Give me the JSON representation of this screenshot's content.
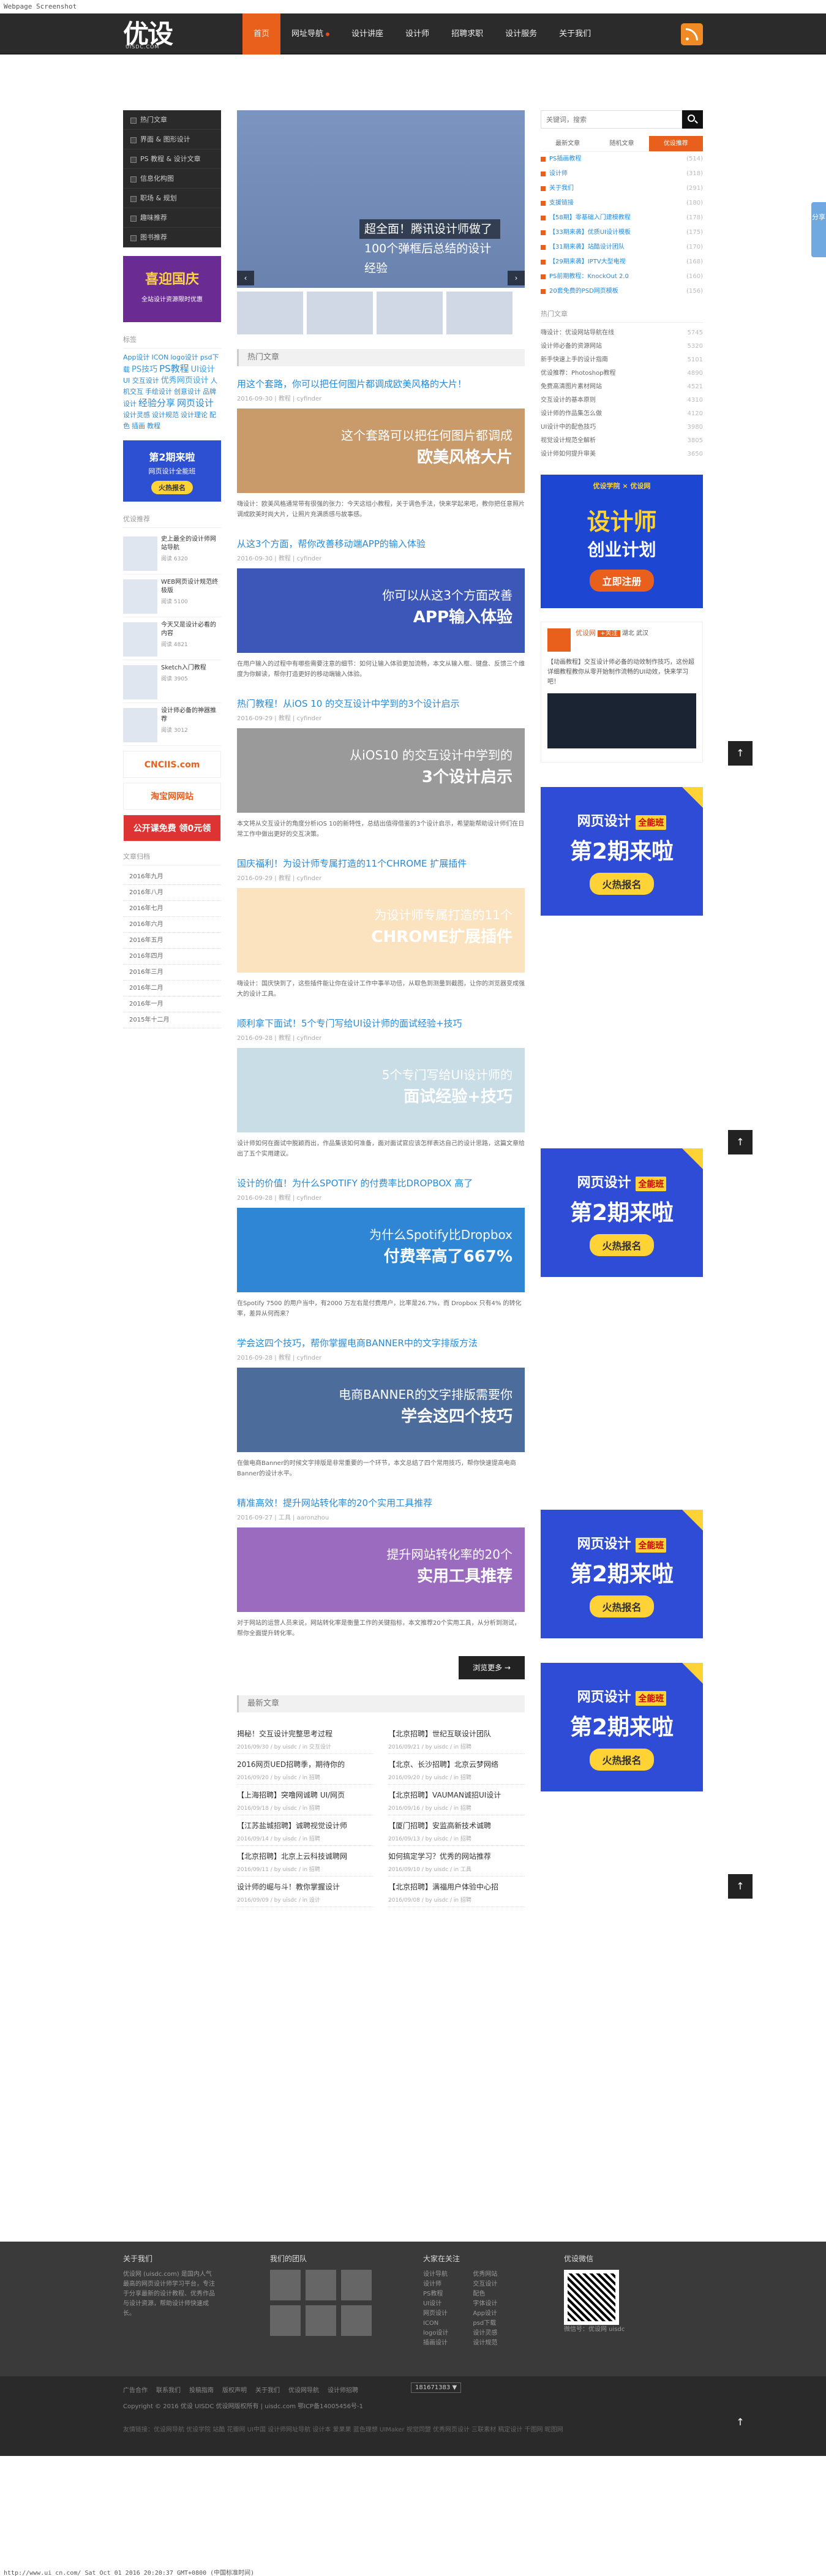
{
  "browser": {
    "top": "Webpage Screenshot",
    "bottom": "http://www.ui cn.com/ Sat Oct 01 2016 20:20:37 GMT+0800 (中国标准时间)"
  },
  "nav": {
    "logo": "优设",
    "logo_sub": "UISDC.COM",
    "items": [
      "首页",
      "网址导航",
      "设计讲座",
      "设计师",
      "招聘求职",
      "设计服务",
      "关于我们"
    ]
  },
  "left": {
    "categories": [
      "热门文章",
      "界面 & 图形设计",
      "PS 教程 & 设计文章",
      "信息化构图",
      "职场 & 规划",
      "趣味推荐",
      "图书推荐"
    ],
    "ad1": {
      "title": "喜迎国庆",
      "sub": "全站设计资源限时优惠"
    },
    "tags_title": "标签",
    "tags": [
      "App设计",
      "ICON",
      "logo设计",
      "psd下载",
      "PS技巧",
      "PS教程",
      "UI设计",
      "UI 交互设计",
      "优秀网页设计",
      "人机交互",
      "手绘设计",
      "创意设计",
      "品牌设计",
      "经验分享",
      "网页设计",
      "设计灵感",
      "设计规范",
      "设计理论",
      "配色",
      "插画",
      "教程"
    ],
    "ad2": {
      "title": "第2期来啦",
      "sub": "网页设计全能班",
      "btn": "火热报名"
    },
    "hot_title": "优设推荐",
    "hot": [
      {
        "t": "史上最全的设计师网站导航",
        "m": "阅读 6320"
      },
      {
        "t": "WEB网页设计规范终极版",
        "m": "阅读 5100"
      },
      {
        "t": "今天又是设计必看的内容",
        "m": "阅读 4821"
      },
      {
        "t": "Sketch入门教程",
        "m": "阅读 3905"
      },
      {
        "t": "设计师必备的神器推荐",
        "m": "阅读 3012"
      }
    ],
    "ads": [
      "CNCIIS.com",
      "淘宝网网站",
      "公开课免费 领0元领"
    ],
    "archive_title": "文章归档",
    "archive": [
      "2016年九月",
      "2016年八月",
      "2016年七月",
      "2016年六月",
      "2016年五月",
      "2016年四月",
      "2016年三月",
      "2016年二月",
      "2016年一月",
      "2015年十二月"
    ]
  },
  "slider": {
    "caption": "超全面！腾讯设计师做了100个弹框后总结的设计经验"
  },
  "main": {
    "hot_title": "热门文章",
    "posts": [
      {
        "title": "用这个套路，你可以把任何图片都调成欧美风格的大片！",
        "meta": "2016-09-30 | 教程 | cyfinder",
        "img1": "这个套路可以把任何图片都调成",
        "img2": "欧美风格大片",
        "desc": "嗨设计：欧美风格通常带有很强的张力：今天这组小教程，关于调色手法，快来学起来吧，教你把任意照片调成欧美时尚大片，让照片充满质感与故事感。",
        "bg": "#c99a6a"
      },
      {
        "title": "从这3个方面，帮你改善移动端APP的输入体验",
        "meta": "2016-09-30 | 教程 | cyfinder",
        "img1": "你可以从这3个方面改善",
        "img2": "APP输入体验",
        "desc": "在用户输入的过程中有哪些需要注意的细节：如何让输入体验更加流畅，本文从输入框、键盘、反馈三个维度为你解读，帮你打造更好的移动端输入体验。",
        "bg": "#3c57b8"
      },
      {
        "title": "热门教程！从iOS 10 的交互设计中学到的3个设计启示",
        "meta": "2016-09-29 | 教程 | cyfinder",
        "img1": "从iOS10 的交互设计中学到的",
        "img2": "3个设计启示",
        "desc": "本文将从交互设计的角度分析iOS 10的新特性，总结出值得借鉴的3个设计启示，希望能帮助设计师们在日常工作中做出更好的交互决策。",
        "bg": "#9a9a9a"
      },
      {
        "title": "国庆福利！为设计师专属打造的11个CHROME 扩展插件",
        "meta": "2016-09-29 | 教程 | cyfinder",
        "img1": "为设计师专属打造的11个",
        "img2": "CHROME扩展插件",
        "desc": "嗨设计：国庆快到了，这些插件能让你在设计工作中事半功倍，从取色到测量到截图，让你的浏览器变成强大的设计工具。",
        "bg": "#fbe3c0"
      },
      {
        "title": "顺利拿下面试！5个专门写给UI设计师的面试经验+技巧",
        "meta": "2016-09-28 | 教程 | cyfinder",
        "img1": "5个专门写给UI设计师的",
        "img2": "面试经验+技巧",
        "desc": "设计师如何在面试中脱颖而出，作品集该如何准备，面对面试官应该怎样表达自己的设计思路，这篇文章给出了五个实用建议。",
        "bg": "#c8dde6"
      },
      {
        "title": "设计的价值！为什么SPOTIFY 的付费率比DROPBOX 高了",
        "meta": "2016-09-28 | 教程 | cyfinder",
        "img1": "为什么Spotify比Dropbox",
        "img2": "付费率高了667%",
        "desc": "在Spotify 7500 的用户当中，有2000 万左右是付费用户，比率是26.7%，而 Dropbox 只有4% 的转化率，差异从何而来？",
        "bg": "#2e86d4"
      },
      {
        "title": "学会这四个技巧，帮你掌握电商BANNER中的文字排版方法",
        "meta": "2016-09-28 | 教程 | cyfinder",
        "img1": "电商BANNER的文字排版需要你",
        "img2": "学会这四个技巧",
        "desc": "在做电商Banner的时候文字排版是非常重要的一个环节，本文总结了四个常用技巧，帮你快速提高电商Banner的设计水平。",
        "bg": "#4c6d9c"
      },
      {
        "title": "精准高效！提升网站转化率的20个实用工具推荐",
        "meta": "2016-09-27 | 工具 | aaronzhou",
        "img1": "提升网站转化率的20个",
        "img2": "实用工具推荐",
        "desc": "对于网站的运营人员来说，网站转化率是衡量工作的关键指标，本文推荐20个实用工具，从分析到测试，帮你全面提升转化率。",
        "bg": "#9a6bbf"
      }
    ],
    "more_btn": "浏览更多 →",
    "new_title": "最新文章",
    "new": [
      {
        "t": "揭秘！交互设计完整思考过程",
        "m": "2016/09/30 / by uisdc / in 交互设计"
      },
      {
        "t": "【北京招聘】世纪互联设计团队",
        "m": "2016/09/21 / by uisdc / in 招聘"
      },
      {
        "t": "2016网页UED招聘季，期待你的",
        "m": "2016/09/20 / by uisdc / in 招聘"
      },
      {
        "t": "【北京、长沙招聘】北京云梦网络",
        "m": "2016/09/20 / by uisdc / in 招聘"
      },
      {
        "t": "【上海招聘】突噜网诚聘 UI/网页",
        "m": "2016/09/18 / by uisdc / in 招聘"
      },
      {
        "t": "【北京招聘】VAUMAN诚招UI设计",
        "m": "2016/09/16 / by uisdc / in 招聘"
      },
      {
        "t": "【江苏盐城招聘】诚聘视觉设计师",
        "m": "2016/09/14 / by uisdc / in 招聘"
      },
      {
        "t": "【厦门招聘】安监高新技术诚聘",
        "m": "2016/09/13 / by uisdc / in 招聘"
      },
      {
        "t": "【北京招聘】北京上云科技诚聘网",
        "m": "2016/09/11 / by uisdc / in 招聘"
      },
      {
        "t": "如何搞定学习？优秀的网站推荐",
        "m": "2016/09/10 / by uisdc / in 工具"
      },
      {
        "t": "设计师的崛与斗！教你掌握设计",
        "m": "2016/09/09 / by uisdc / in 设计"
      },
      {
        "t": "【北京招聘】满福用户体验中心招",
        "m": "2016/09/08 / by uisdc / in 招聘"
      }
    ]
  },
  "right": {
    "search_placeholder": "关键词，搜索",
    "tabs": [
      "最新文章",
      "随机文章",
      "优设推荐"
    ],
    "list": [
      {
        "t": "PS插画教程",
        "n": "(514)"
      },
      {
        "t": "设计师",
        "n": "(318)"
      },
      {
        "t": "关于我们",
        "n": "(291)"
      },
      {
        "t": "支援链接",
        "n": "(180)"
      },
      {
        "t": "【58期】零基础入门建模教程",
        "n": "(178)"
      },
      {
        "t": "【33期来袭】优质UI设计模板",
        "n": "(175)"
      },
      {
        "t": "【31期来袭】站酷设计团队",
        "n": "(170)"
      },
      {
        "t": "【29期来袭】IPTV大型电视",
        "n": "(168)"
      },
      {
        "t": "PS前期教程：KnockOut 2.0",
        "n": "(160)"
      },
      {
        "t": "20套免费的PSD网页模板",
        "n": "(156)"
      }
    ],
    "hot_title": "热门文章",
    "hot": [
      {
        "t": "嗨设计：优设网站导航在线",
        "n": "5745"
      },
      {
        "t": "设计师必备的资源网站",
        "n": "5320"
      },
      {
        "t": "新手快速上手的设计指南",
        "n": "5101"
      },
      {
        "t": "优设推荐：Photoshop教程",
        "n": "4890"
      },
      {
        "t": "免费高清图片素材网站",
        "n": "4521"
      },
      {
        "t": "交互设计的基本原则",
        "n": "4310"
      },
      {
        "t": "设计师的作品集怎么做",
        "n": "4120"
      },
      {
        "t": "UI设计中的配色技巧",
        "n": "3980"
      },
      {
        "t": "视觉设计规范全解析",
        "n": "3805"
      },
      {
        "t": "设计师如何提升审美",
        "n": "3650"
      }
    ],
    "ad1": {
      "top": "优设学院 × 优设网",
      "a1": "设计师",
      "a2": "创业计划",
      "btn": "立即注册"
    },
    "weibo": {
      "name": "优设网",
      "follow": "+关注",
      "loc": "湖北 武汉",
      "text": "【动画教程】交互设计师必备的动效制作技巧，这份超详细教程教你从零开始制作流畅的UI动效，快来学习吧！"
    },
    "ads": [
      {
        "l1": "网页设计",
        "lab": "全能班",
        "l2": "第2期来啦",
        "btn": "火热报名"
      },
      {
        "l1": "网页设计",
        "lab": "全能班",
        "l2": "第2期来啦",
        "btn": "火热报名"
      },
      {
        "l1": "网页设计",
        "lab": "全能班",
        "l2": "第2期来啦",
        "btn": "火热报名"
      },
      {
        "l1": "网页设计",
        "lab": "全能班",
        "l2": "第2期来啦",
        "btn": "火热报名"
      }
    ]
  },
  "share": "分享",
  "footer": {
    "about_title": "关于我们",
    "about": "优设网 (uisdc.com) 是国内人气最高的网页设计师学习平台，专注于分享最新的设计教程、优秀作品与设计资源，帮助设计师快速成长。",
    "friends_title": "我们的团队",
    "links_title": "大家在关注",
    "links_a": [
      "设计导航",
      "设计师",
      "PS教程",
      "UI设计",
      "网页设计",
      "ICON",
      "logo设计",
      "插画设计"
    ],
    "links_b": [
      "优秀网站",
      "交互设计",
      "配色",
      "字体设计",
      "App设计",
      "psd下载",
      "设计灵感",
      "设计规范"
    ],
    "wechat_title": "优设微信",
    "wechat_note": "微信号：优设网 uisdc",
    "bottom_links": [
      "广告合作",
      "联系我们",
      "投稿指南",
      "版权声明",
      "关于我们",
      "优设网导航",
      "设计师招聘"
    ],
    "copyright": "Copyright © 2016 优设 UISDC 优设网版权所有 | uisdc.com 鄂ICP备14005456号-1",
    "select": "181671383 ▼",
    "friends": "友情链接：优设网导航 优设学院 站酷 花瓣网 UI中国 设计师网址导航 设计本 爱果果 蓝色理想 UIMaker 视觉同盟 优秀网页设计 三联素材 稿定设计 千图网 昵图网"
  }
}
